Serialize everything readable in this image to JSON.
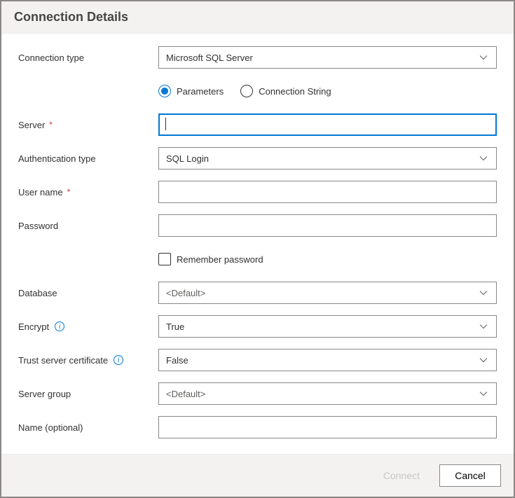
{
  "header": {
    "title": "Connection Details"
  },
  "labels": {
    "connectionType": "Connection type",
    "server": "Server",
    "authType": "Authentication type",
    "userName": "User name",
    "password": "Password",
    "rememberPassword": "Remember password",
    "database": "Database",
    "encrypt": "Encrypt",
    "trustCert": "Trust server certificate",
    "serverGroup": "Server group",
    "nameOptional": "Name (optional)"
  },
  "values": {
    "connectionType": "Microsoft SQL Server",
    "authType": "SQL Login",
    "server": "",
    "userName": "",
    "password": "",
    "database": "<Default>",
    "encrypt": "True",
    "trustCert": "False",
    "serverGroup": "<Default>",
    "nameOptional": ""
  },
  "radio": {
    "parameters": "Parameters",
    "connectionString": "Connection String"
  },
  "footer": {
    "connect": "Connect",
    "cancel": "Cancel"
  }
}
